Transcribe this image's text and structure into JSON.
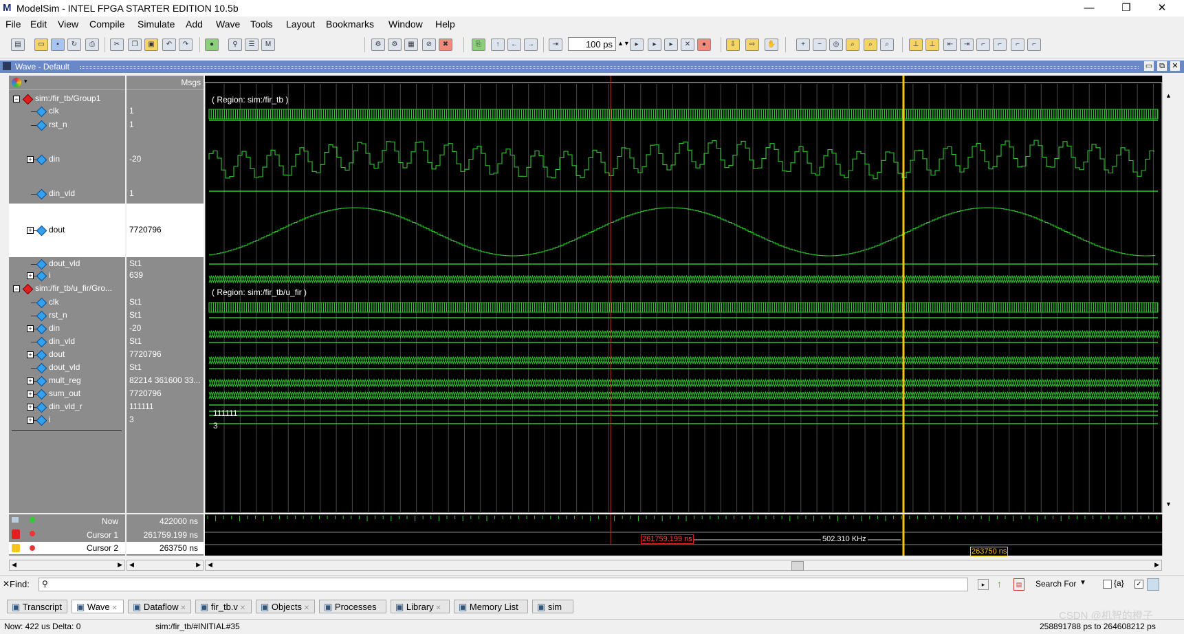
{
  "window": {
    "title": "ModelSim - INTEL FPGA STARTER EDITION 10.5b",
    "logo": "M",
    "minimize": "—",
    "restore": "❐",
    "close": "✕"
  },
  "menu": [
    "File",
    "Edit",
    "View",
    "Compile",
    "Simulate",
    "Add",
    "Wave",
    "Tools",
    "Layout",
    "Bookmarks",
    "Window",
    "Help"
  ],
  "toolbar": {
    "zoom_value": "100 ps"
  },
  "wave_window": {
    "title": "Wave - Default",
    "msgs_header": "Msgs"
  },
  "signals": [
    {
      "name": "sim:/fir_tb/Group1",
      "value": "",
      "group": true
    },
    {
      "name": "clk",
      "value": "1"
    },
    {
      "name": "rst_n",
      "value": "1"
    },
    {
      "name": "din",
      "value": "-20",
      "expand": true
    },
    {
      "name": "din_vld",
      "value": "1"
    },
    {
      "name": "dout",
      "value": "7720796",
      "expand": true
    },
    {
      "name": "dout_vld",
      "value": "St1"
    },
    {
      "name": "i",
      "value": "639",
      "expand": true
    },
    {
      "name": "sim:/fir_tb/u_fir/Gro...",
      "value": "",
      "group": true
    },
    {
      "name": "clk",
      "value": "St1"
    },
    {
      "name": "rst_n",
      "value": "St1"
    },
    {
      "name": "din",
      "value": "-20",
      "expand": true
    },
    {
      "name": "din_vld",
      "value": "St1"
    },
    {
      "name": "dout",
      "value": "7720796",
      "expand": true
    },
    {
      "name": "dout_vld",
      "value": "St1"
    },
    {
      "name": "mult_reg",
      "value": "82214 361600 33...",
      "expand": true
    },
    {
      "name": "sum_out",
      "value": "7720796",
      "expand": true
    },
    {
      "name": "din_vld_r",
      "value": "111111",
      "expand": true
    },
    {
      "name": "i",
      "value": "3",
      "expand": true
    }
  ],
  "wave_labels": {
    "region1": "( Region: sim:/fir_tb )",
    "region2": "( Region: sim:/fir_tb/u_fir )",
    "din_vld_r": "111111",
    "i": "3"
  },
  "cursors": {
    "now_label": "Now",
    "now_value": "422000 ns",
    "cursor1_label": "Cursor 1",
    "cursor1_value": "261759.199 ns",
    "cursor2_label": "Cursor 2",
    "cursor2_value": "263750 ns",
    "cursor1_tag": "261759.199 ns",
    "cursor2_tag": "263750 ns",
    "delta_label": "502.310 KHz"
  },
  "find": {
    "label": "Find:",
    "search_for": "Search For",
    "regex": "{a}"
  },
  "tabs": [
    "Transcript",
    "Wave",
    "Dataflow",
    "fir_tb.v",
    "Objects",
    "Processes",
    "Library",
    "Memory List",
    "sim"
  ],
  "status": {
    "now": "Now: 422 us  Delta: 0",
    "context": "sim:/fir_tb/#INITIAL#35",
    "range": "258891788 ps to 264608212 ps"
  },
  "watermark": "CSDN @机智的橙子",
  "colors": {
    "wave_green": "#2ec82e",
    "cursor1": "#e01818",
    "cursor2": "#f5c518",
    "wave_bg": "#000000"
  }
}
